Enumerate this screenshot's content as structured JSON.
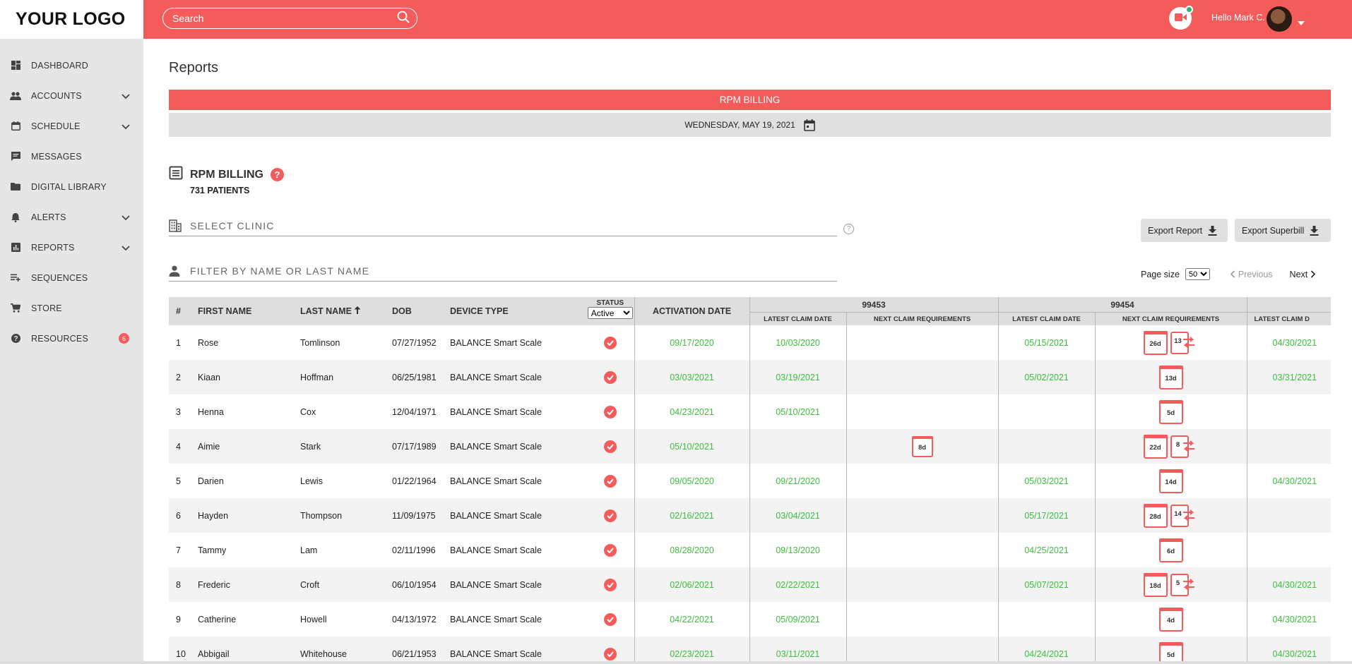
{
  "logo": "YOUR LOGO",
  "search": {
    "placeholder": "Search"
  },
  "header": {
    "greeting": "Hello Mark C."
  },
  "sidebar": {
    "items": [
      {
        "label": "DASHBOARD",
        "icon": "dashboard-icon",
        "chevron": false
      },
      {
        "label": "ACCOUNTS",
        "icon": "people-icon",
        "chevron": true
      },
      {
        "label": "SCHEDULE",
        "icon": "calendar-icon",
        "chevron": true
      },
      {
        "label": "MESSAGES",
        "icon": "message-icon",
        "chevron": false
      },
      {
        "label": "DIGITAL LIBRARY",
        "icon": "folder-icon",
        "chevron": false
      },
      {
        "label": "ALERTS",
        "icon": "bell-icon",
        "chevron": true
      },
      {
        "label": "REPORTS",
        "icon": "bar-chart-icon",
        "chevron": true
      },
      {
        "label": "SEQUENCES",
        "icon": "playlist-icon",
        "chevron": false
      },
      {
        "label": "STORE",
        "icon": "cart-icon",
        "chevron": false
      },
      {
        "label": "RESOURCES",
        "icon": "help-icon",
        "chevron": false,
        "badge": "6"
      }
    ]
  },
  "page": {
    "title": "Reports",
    "banner": "RPM BILLING",
    "date": "WEDNESDAY, MAY 19, 2021",
    "section_title": "RPM BILLING",
    "help": "?",
    "patients": "731 PATIENTS",
    "clinic_placeholder": "SELECT CLINIC",
    "filter_placeholder": "FILTER BY NAME OR LAST NAME",
    "export_report": "Export Report",
    "export_superbill": "Export Superbill",
    "page_size_label": "Page size",
    "page_size_value": "50",
    "previous": "Previous",
    "next": "Next"
  },
  "table": {
    "headers": {
      "num": "#",
      "first": "FIRST NAME",
      "last": "LAST NAME",
      "dob": "DOB",
      "device": "DEVICE TYPE",
      "status": "STATUS",
      "status_value": "Active",
      "activation": "ACTIVATION DATE",
      "group1": "99453",
      "group2": "99454",
      "latest_claim": "LATEST CLAIM DATE",
      "next_claim": "NEXT CLAIM REQUIREMENTS",
      "latest_claim_cut": "LATEST CLAIM D"
    },
    "rows": [
      {
        "n": "1",
        "first": "Rose",
        "last": "Tomlinson",
        "dob": "07/27/1952",
        "device": "BALANCE Smart Scale",
        "activation": "09/17/2020",
        "c1": "10/03/2020",
        "n1": "",
        "c2": "05/15/2021",
        "cal2": "26d",
        "sync2": "13",
        "c3": "04/30/2021"
      },
      {
        "n": "2",
        "first": "Kiaan",
        "last": "Hoffman",
        "dob": "06/25/1981",
        "device": "BALANCE Smart Scale",
        "activation": "03/03/2021",
        "c1": "03/19/2021",
        "n1": "",
        "c2": "05/02/2021",
        "cal2": "13d",
        "sync2": "",
        "c3": "03/31/2021"
      },
      {
        "n": "3",
        "first": "Henna",
        "last": "Cox",
        "dob": "12/04/1971",
        "device": "BALANCE Smart Scale",
        "activation": "04/23/2021",
        "c1": "05/10/2021",
        "n1": "",
        "c2": "",
        "cal2": "5d",
        "sync2": "",
        "c3": ""
      },
      {
        "n": "4",
        "first": "Aimie",
        "last": "Stark",
        "dob": "07/17/1989",
        "device": "BALANCE Smart Scale",
        "activation": "05/10/2021",
        "c1": "",
        "n1": "8d",
        "c2": "",
        "cal2": "22d",
        "sync2": "8",
        "c3": ""
      },
      {
        "n": "5",
        "first": "Darien",
        "last": "Lewis",
        "dob": "01/22/1964",
        "device": "BALANCE Smart Scale",
        "activation": "09/05/2020",
        "c1": "09/21/2020",
        "n1": "",
        "c2": "05/03/2021",
        "cal2": "14d",
        "sync2": "",
        "c3": "04/30/2021"
      },
      {
        "n": "6",
        "first": "Hayden",
        "last": "Thompson",
        "dob": "11/09/1975",
        "device": "BALANCE Smart Scale",
        "activation": "02/16/2021",
        "c1": "03/04/2021",
        "n1": "",
        "c2": "05/17/2021",
        "cal2": "28d",
        "sync2": "14",
        "c3": ""
      },
      {
        "n": "7",
        "first": "Tammy",
        "last": "Lam",
        "dob": "02/11/1996",
        "device": "BALANCE Smart Scale",
        "activation": "08/28/2020",
        "c1": "09/13/2020",
        "n1": "",
        "c2": "04/25/2021",
        "cal2": "6d",
        "sync2": "",
        "c3": ""
      },
      {
        "n": "8",
        "first": "Frederic",
        "last": "Croft",
        "dob": "06/10/1954",
        "device": "BALANCE Smart Scale",
        "activation": "02/06/2021",
        "c1": "02/22/2021",
        "n1": "",
        "c2": "05/07/2021",
        "cal2": "18d",
        "sync2": "5",
        "c3": "04/30/2021"
      },
      {
        "n": "9",
        "first": "Catherine",
        "last": "Howell",
        "dob": "04/13/1972",
        "device": "BALANCE Smart Scale",
        "activation": "04/22/2021",
        "c1": "05/09/2021",
        "n1": "",
        "c2": "",
        "cal2": "4d",
        "sync2": "",
        "c3": "04/30/2021"
      },
      {
        "n": "10",
        "first": "Abbigail",
        "last": "Whitehouse",
        "dob": "06/21/1953",
        "device": "BALANCE Smart Scale",
        "activation": "02/23/2021",
        "c1": "03/11/2021",
        "n1": "",
        "c2": "04/24/2021",
        "cal2": "5d",
        "sync2": "",
        "c3": "04/30/2021"
      }
    ]
  },
  "colors": {
    "accent": "#f45b5b",
    "green": "#3cbf3c",
    "sidebar": "#e6e6e6"
  }
}
